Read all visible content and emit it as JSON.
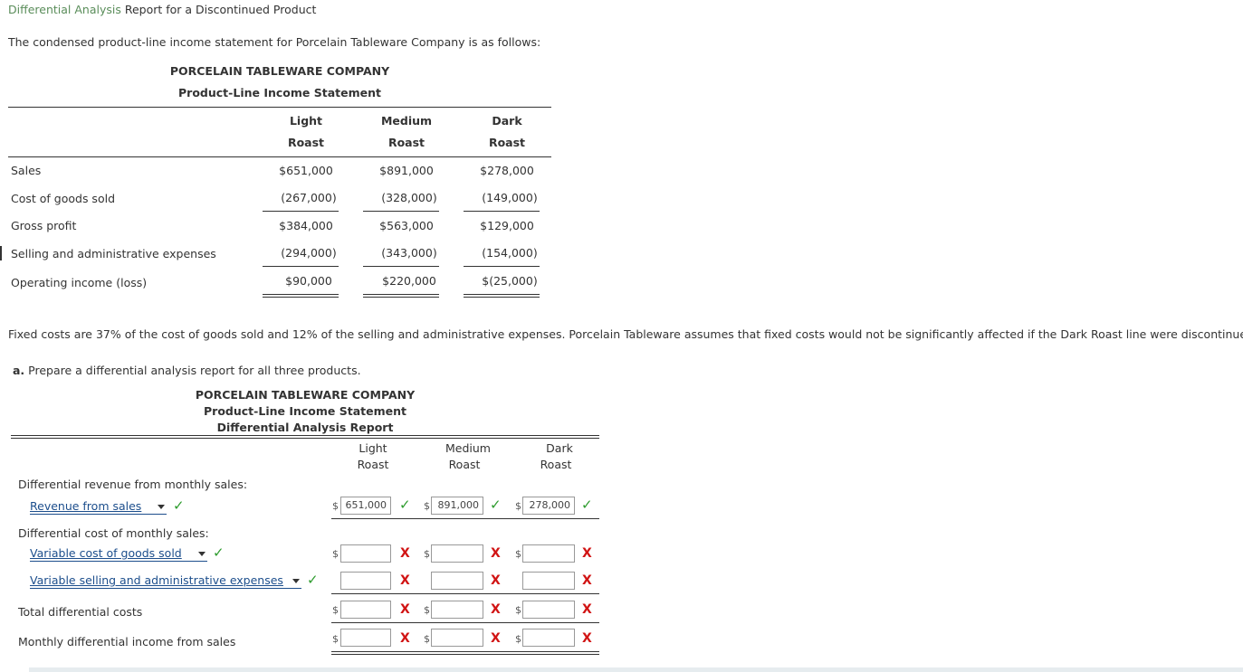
{
  "header": {
    "title_link": "Differential Analysis",
    "title_rest": " Report for a Discontinued Product"
  },
  "intro": "The condensed product-line income statement for Porcelain Tableware Company is as follows:",
  "statement": {
    "company": "PORCELAIN TABLEWARE COMPANY",
    "subtitle": "Product-Line Income Statement",
    "columns": [
      {
        "line1": "Light",
        "line2": "Roast"
      },
      {
        "line1": "Medium",
        "line2": "Roast"
      },
      {
        "line1": "Dark",
        "line2": "Roast"
      }
    ],
    "rows": [
      {
        "label": "Sales",
        "values": [
          "$651,000",
          "$891,000",
          "$278,000"
        ]
      },
      {
        "label": "Cost of goods sold",
        "values": [
          "(267,000)",
          "(328,000)",
          "(149,000)"
        ]
      },
      {
        "label": "Gross profit",
        "values": [
          "$384,000",
          "$563,000",
          "$129,000"
        ]
      },
      {
        "label": "Selling and administrative expenses",
        "values": [
          "(294,000)",
          "(343,000)",
          "(154,000)"
        ]
      },
      {
        "label": "Operating income (loss)",
        "values": [
          "$90,000",
          "$220,000",
          "$(25,000)"
        ]
      }
    ]
  },
  "fixed_costs_note": "Fixed costs are 37% of the cost of goods sold and 12% of the selling and administrative expenses. Porcelain Tableware assumes that fixed costs would not be significantly affected if the Dark Roast line were discontinued.",
  "part_a": {
    "letter": "a.",
    "text": "Prepare a differential analysis report for all three products."
  },
  "report": {
    "company": "PORCELAIN TABLEWARE COMPANY",
    "subtitle": "Product-Line Income Statement",
    "subtitle2": "Differential Analysis Report",
    "columns": [
      {
        "line1": "Light",
        "line2": "Roast"
      },
      {
        "line1": "Medium",
        "line2": "Roast"
      },
      {
        "line1": "Dark",
        "line2": "Roast"
      }
    ],
    "revenue_heading": "Differential revenue from monthly sales:",
    "revenue_select": "Revenue from sales",
    "revenue_values": [
      "651,000",
      "891,000",
      "278,000"
    ],
    "cost_heading": "Differential cost of monthly sales:",
    "cost_select_1": "Variable cost of goods sold",
    "cost_select_2": "Variable selling and administrative expenses",
    "total_costs_label": "Total differential costs",
    "income_label": "Monthly differential income from sales",
    "dollar_sign": "$",
    "check_glyph": "✓",
    "x_glyph": "X"
  }
}
